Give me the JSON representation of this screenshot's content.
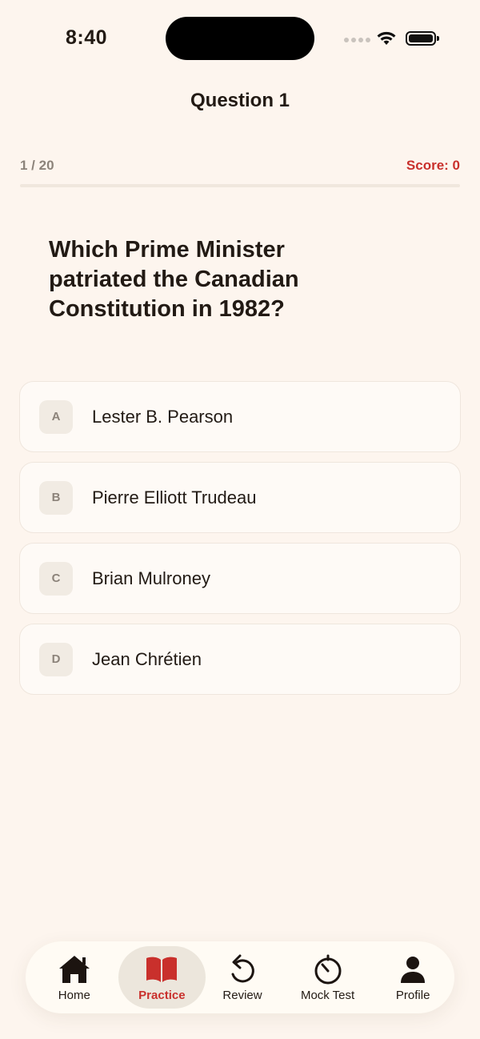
{
  "status": {
    "time": "8:40"
  },
  "header": {
    "title": "Question 1"
  },
  "progress": {
    "counter": "1 / 20",
    "score": "Score: 0",
    "fraction": 0.0
  },
  "question": {
    "text": "Which Prime Minister patriated the Canadian Constitution in 1982?"
  },
  "answers": [
    {
      "letter": "A",
      "text": "Lester B. Pearson"
    },
    {
      "letter": "B",
      "text": "Pierre Elliott Trudeau"
    },
    {
      "letter": "C",
      "text": "Brian Mulroney"
    },
    {
      "letter": "D",
      "text": "Jean Chrétien"
    }
  ],
  "tabs": [
    {
      "label": "Home",
      "icon": "home-icon"
    },
    {
      "label": "Practice",
      "icon": "book-icon",
      "active": true
    },
    {
      "label": "Review",
      "icon": "undo-icon"
    },
    {
      "label": "Mock Test",
      "icon": "timer-icon"
    },
    {
      "label": "Profile",
      "icon": "person-icon"
    }
  ],
  "colors": {
    "accent": "#c9302c",
    "background": "#fdf5ee",
    "text": "#221a14",
    "muted": "#8c837a"
  }
}
